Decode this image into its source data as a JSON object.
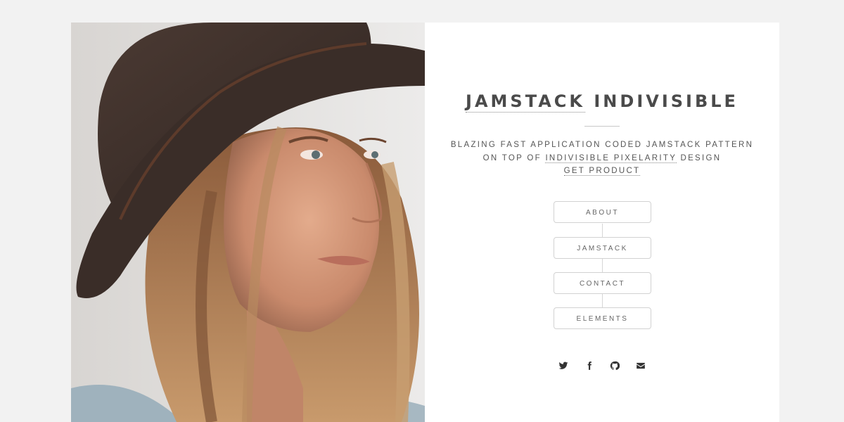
{
  "title": {
    "linked": "JAMSTACK",
    "rest": "INDIVISIBLE"
  },
  "tagline": {
    "line1": "BLAZING FAST APPLICATION CODED JAMSTACK PATTERN",
    "line2_prefix": "ON TOP OF",
    "line2_link": "INDIVISIBLE PIXELARITY",
    "line2_suffix": "DESIGN",
    "line3_link": "GET PRODUCT"
  },
  "nav": [
    {
      "label": "ABOUT"
    },
    {
      "label": "JAMSTACK"
    },
    {
      "label": "CONTACT"
    },
    {
      "label": "ELEMENTS"
    }
  ],
  "social": [
    "twitter-icon",
    "facebook-icon",
    "github-icon",
    "envelope-icon"
  ],
  "colors": {
    "page_bg": "#f2f2f2",
    "panel_bg": "#ffffff",
    "text": "#4a4a4a",
    "border": "#d2d2d2"
  }
}
